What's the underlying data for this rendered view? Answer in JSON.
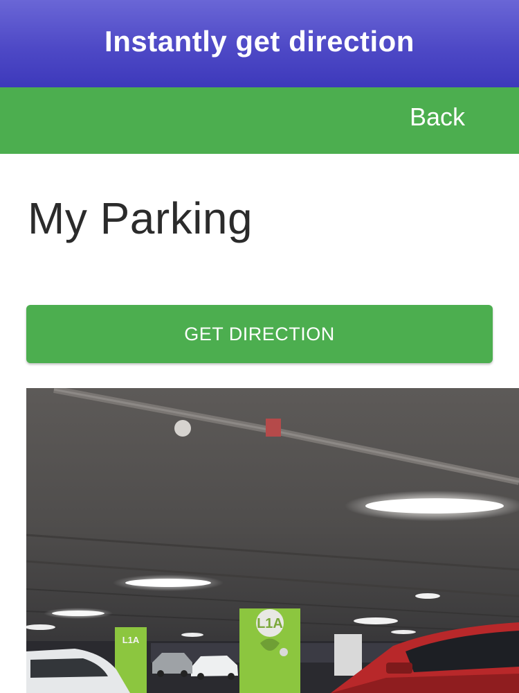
{
  "header": {
    "title": "Instantly get direction"
  },
  "nav": {
    "back_label": "Back"
  },
  "main": {
    "page_title": "My Parking",
    "direction_button_label": "GET DIRECTION",
    "photo": {
      "subject": "parking-garage-photo",
      "pillar_signs": [
        "L1A",
        "L1A"
      ],
      "colors": {
        "ceiling": "#5a5856",
        "pillar": "#8cc63f",
        "car_red": "#b8282a",
        "car_white": "#e9ecee"
      }
    }
  },
  "theme": {
    "banner_color": "#4e49c6",
    "accent_green": "#4cae4f",
    "text_dark": "#2b2b2b"
  }
}
